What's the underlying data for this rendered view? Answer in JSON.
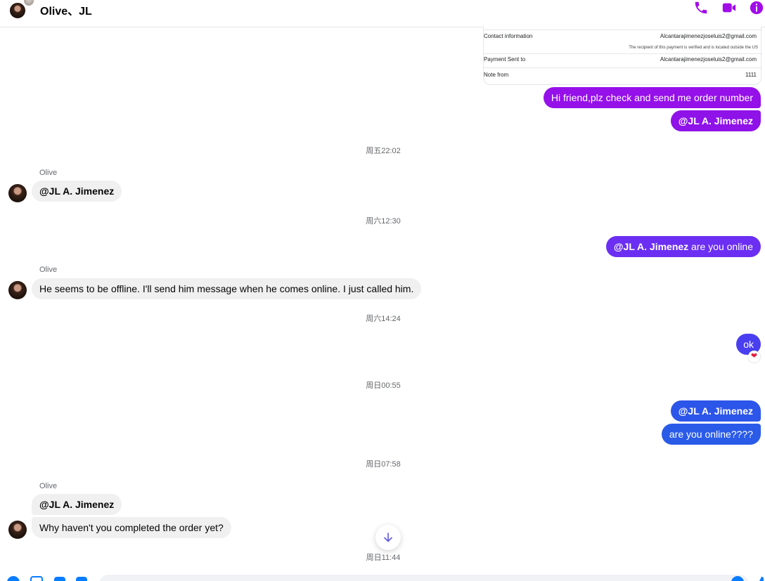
{
  "header": {
    "title": "Olive、JL"
  },
  "colors": {
    "accent": "#a20ce8",
    "bubble_purple": "#9510e9",
    "bubble_violet": "#6b2ef2",
    "bubble_blue": "#2a5be8",
    "incoming": "#f0f0f0"
  },
  "payment": {
    "contact_label": "Contact information",
    "contact_value": "Alcantarajimenezjoseluis2@gmail.com",
    "verified_note": "The recipient of this payment is verified and is located outside the US",
    "sent_to_label": "Payment Sent to",
    "sent_to_value": "Alcantarajimenezjoseluis2@gmail.com",
    "note_label": "Note from",
    "note_value": "1111"
  },
  "messages": {
    "out1": "Hi friend,plz check and send me order number",
    "out2": "@JL A. Jimenez",
    "ts1": "周五22:02",
    "sender1": "Olive",
    "in1": "@JL A. Jimenez",
    "ts2": "周六12:30",
    "out3_mention": "@JL A. Jimenez",
    "out3_text": " are you online",
    "sender2": "Olive",
    "in2": "He seems to be offline. I'll send him message when he comes online. I just called him.",
    "ts3": "周六14:24",
    "out4": "ok",
    "reaction": "❤",
    "ts4": "周日00:55",
    "out5": "@JL A. Jimenez",
    "out6": "are you online????",
    "ts5": "周日07:58",
    "sender3": "Olive",
    "in3": "@JL A. Jimenez",
    "in4": "Why haven't you completed the order yet?",
    "ts6": "周日11:44"
  },
  "icons": {
    "call": "phone-icon",
    "video": "video-icon",
    "info": "info-icon",
    "scroll": "arrow-down-icon"
  }
}
